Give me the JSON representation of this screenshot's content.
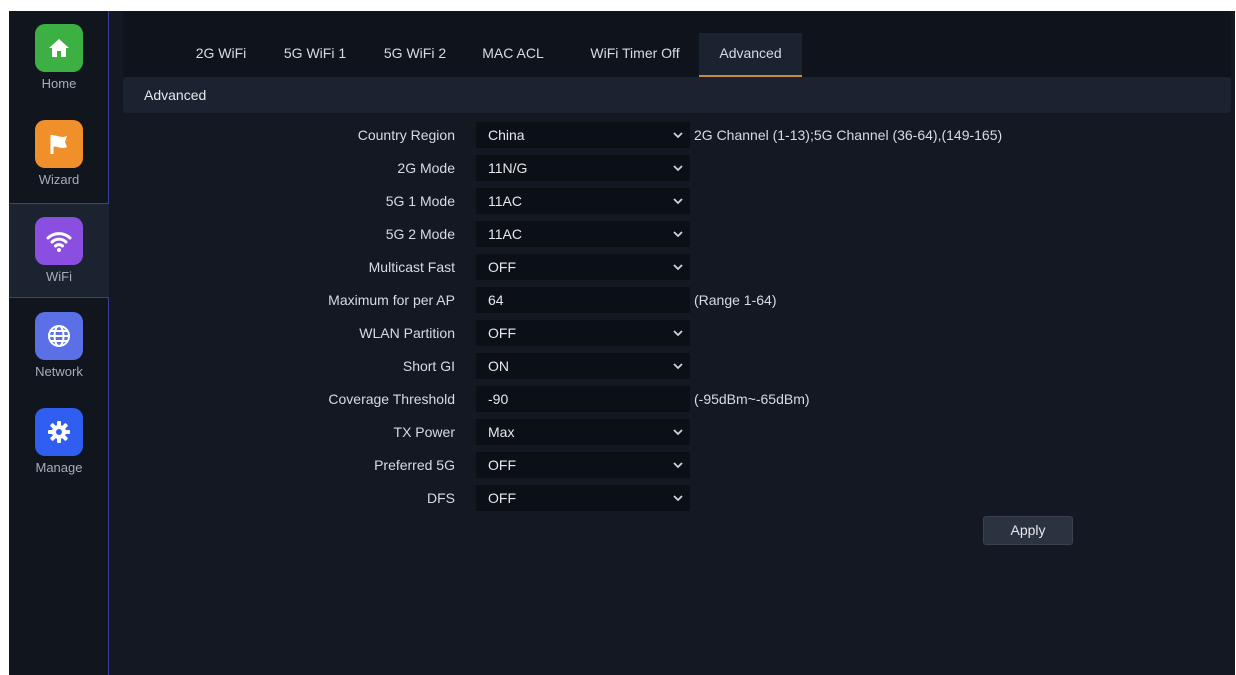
{
  "sidebar": {
    "items": [
      {
        "label": "Home",
        "icon": "home-icon",
        "color": "#3cb043"
      },
      {
        "label": "Wizard",
        "icon": "flag-icon",
        "color": "#f0902a"
      },
      {
        "label": "WiFi",
        "icon": "wifi-icon",
        "color": "#8a4fe0",
        "active": true
      },
      {
        "label": "Network",
        "icon": "globe-icon",
        "color": "#5b6fe6"
      },
      {
        "label": "Manage",
        "icon": "gear-icon",
        "color": "#2f5ef0"
      }
    ]
  },
  "tabs": [
    "2G WiFi",
    "5G WiFi 1",
    "5G WiFi 2",
    "MAC ACL",
    "WiFi Timer Off",
    "Advanced"
  ],
  "active_tab": "Advanced",
  "section_title": "Advanced",
  "form": {
    "country_region": {
      "label": "Country Region",
      "value": "China",
      "hint": "2G Channel (1-13);5G Channel (36-64),(149-165)"
    },
    "mode_2g": {
      "label": "2G Mode",
      "value": "11N/G"
    },
    "mode_5g1": {
      "label": "5G 1 Mode",
      "value": "11AC"
    },
    "mode_5g2": {
      "label": "5G 2 Mode",
      "value": "11AC"
    },
    "multicast_fast": {
      "label": "Multicast Fast",
      "value": "OFF"
    },
    "max_per_ap": {
      "label": "Maximum for per AP",
      "value": "64",
      "hint": "(Range 1-64)"
    },
    "wlan_partition": {
      "label": "WLAN Partition",
      "value": "OFF"
    },
    "short_gi": {
      "label": "Short GI",
      "value": "ON"
    },
    "coverage_threshold": {
      "label": "Coverage Threshold",
      "value": "-90",
      "hint": "(-95dBm~-65dBm)"
    },
    "tx_power": {
      "label": "TX Power",
      "value": "Max"
    },
    "preferred_5g": {
      "label": "Preferred 5G",
      "value": "OFF"
    },
    "dfs": {
      "label": "DFS",
      "value": "OFF"
    }
  },
  "apply_label": "Apply",
  "colors": {
    "accent": "#c98a3a",
    "background": "#131822",
    "field": "#0b0f16"
  }
}
